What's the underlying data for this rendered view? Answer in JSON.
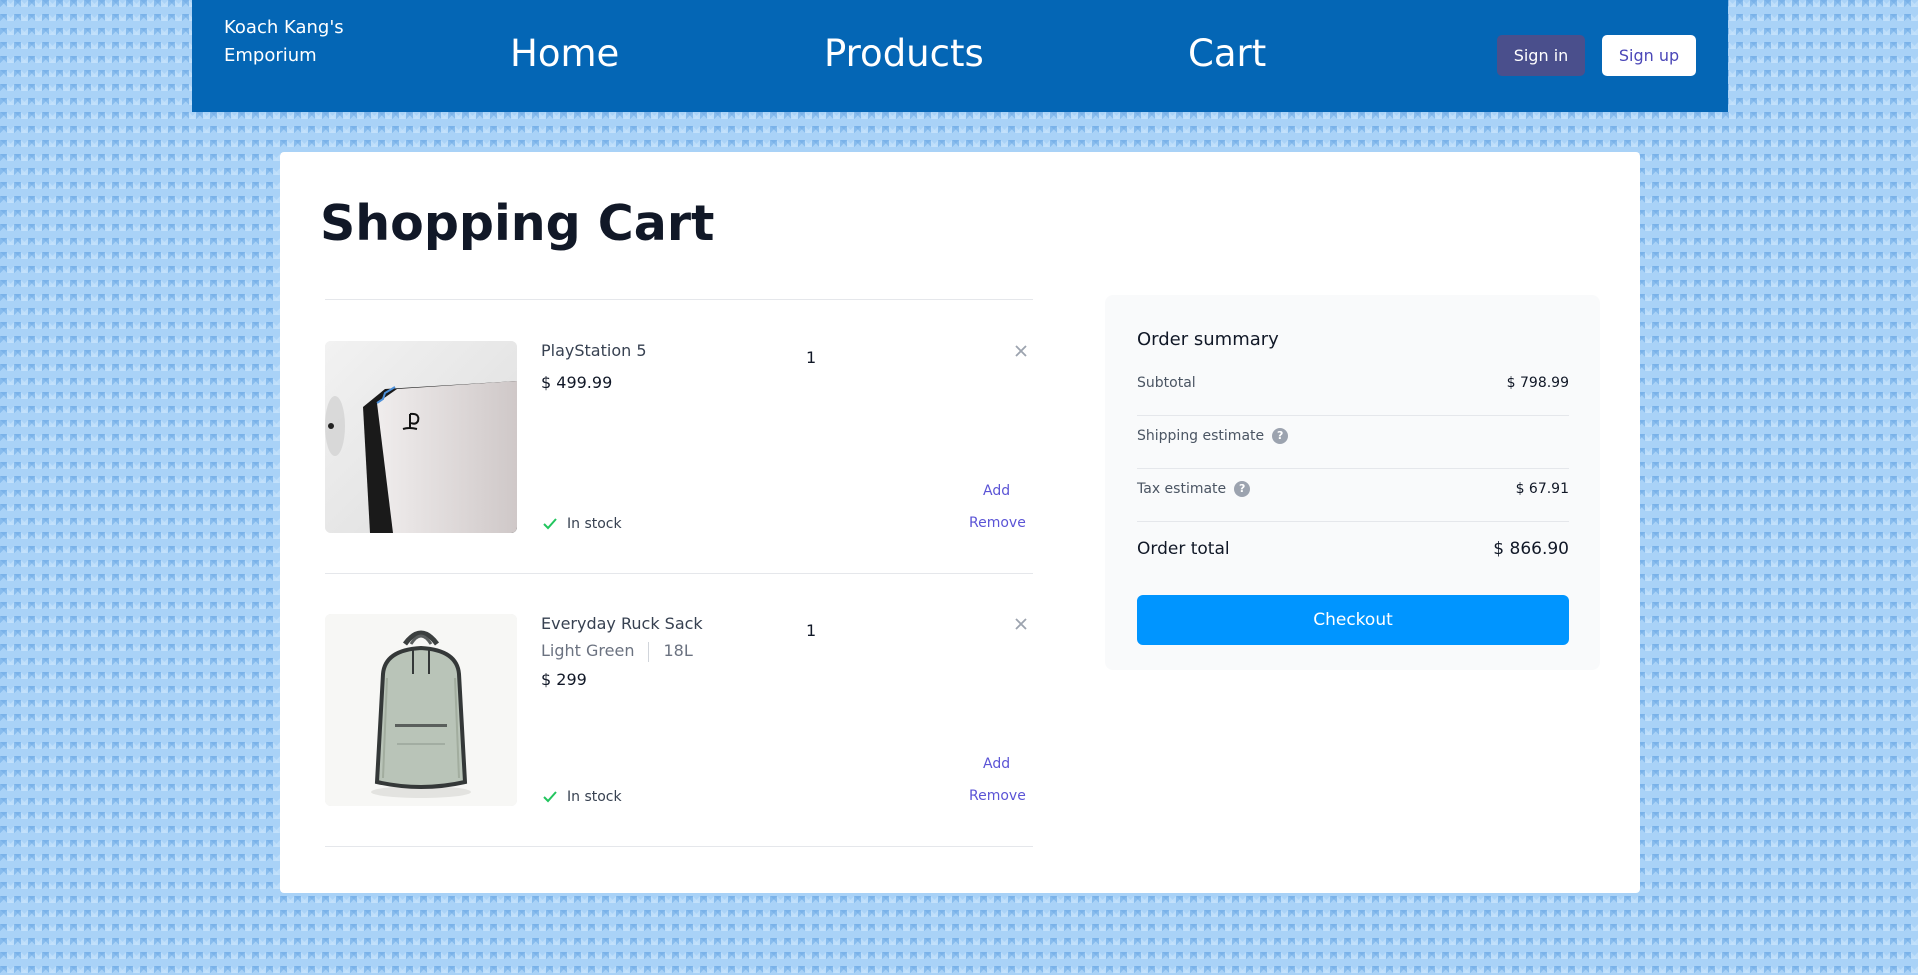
{
  "header": {
    "brand": "Koach Kang's Emporium",
    "nav": {
      "home": "Home",
      "products": "Products",
      "cart": "Cart"
    },
    "sign_in": "Sign in",
    "sign_up": "Sign up"
  },
  "page_title": "Shopping Cart",
  "cart": {
    "items": [
      {
        "name": "PlayStation 5",
        "price": "$ 499.99",
        "quantity": "1",
        "add": "Add",
        "remove": "Remove",
        "stock": "In stock"
      },
      {
        "name": "Everyday Ruck Sack",
        "color": "Light Green",
        "size": "18L",
        "price": "$ 299",
        "quantity": "1",
        "add": "Add",
        "remove": "Remove",
        "stock": "In stock"
      }
    ]
  },
  "summary": {
    "title": "Order summary",
    "subtotal_label": "Subtotal",
    "subtotal_value": "$ 798.99",
    "shipping_label": "Shipping estimate",
    "tax_label": "Tax estimate",
    "tax_value": "$ 67.91",
    "total_label": "Order total",
    "total_value": "$ 866.90",
    "checkout": "Checkout"
  },
  "icons": {
    "remove": "close-icon",
    "stock": "check-icon",
    "help": "question-circle-icon"
  },
  "colors": {
    "header": "#0466b5",
    "sign_in_bg": "#4a4f8c",
    "checkout": "#0095ff",
    "link": "#5b54d6",
    "in_stock": "#22c55e"
  }
}
